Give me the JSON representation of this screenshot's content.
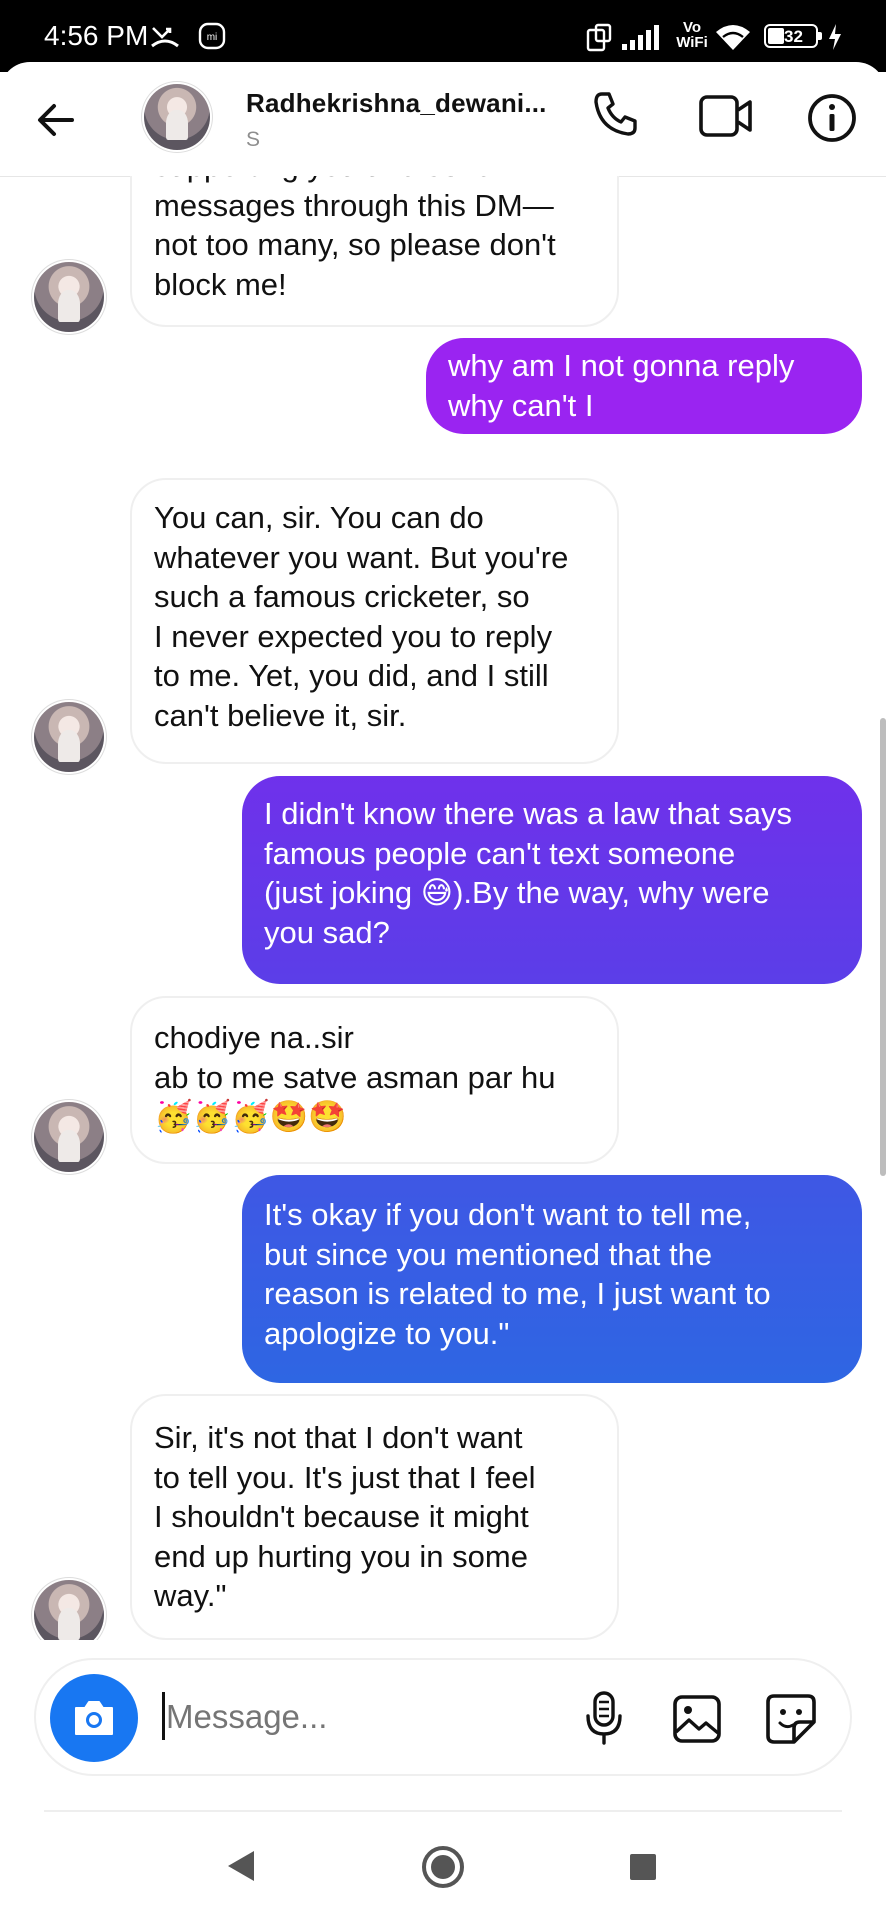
{
  "status_bar": {
    "time": "4:56 PM",
    "icons": [
      "missed-call-icon",
      "mi-icon",
      "screen-rotate-icon",
      "signal-icon",
      "vowifi-icon",
      "wifi-icon",
      "battery-icon",
      "charging-icon"
    ],
    "vowifi_top": "Vo",
    "vowifi_bottom": "WiFi",
    "battery": "32"
  },
  "header": {
    "name": "Radhekrishna_dewani...",
    "subtitle": "S"
  },
  "messages": [
    {
      "side": "in",
      "text": "supporting you and send\nmessages through this DM—\nnot too many, so please don't\nblock me!"
    },
    {
      "side": "out",
      "text": "why am I not gonna reply\nwhy can't I"
    },
    {
      "side": "in",
      "text": "You can, sir. You can do\nwhatever you want. But you're\nsuch a famous cricketer, so\nI never expected you to reply\nto me. Yet, you did, and I still\ncan't believe it, sir."
    },
    {
      "side": "out",
      "text": "I didn't know there was a law that says\nfamous people can't text someone\n(just joking 😅).By the way, why were\nyou sad?"
    },
    {
      "side": "in",
      "text": "chodiye na..sir\nab to me satve asman par hu\n🥳🥳🥳🤩🤩"
    },
    {
      "side": "out",
      "text": "It's okay if you don't want to tell me,\nbut since you mentioned that the\nreason is related to me, I just want to\napologize to you.\""
    },
    {
      "side": "in",
      "text": "Sir, it's not that I don't want\nto tell you. It's just that I feel\nI shouldn't because it might\nend up hurting you in some\nway.\""
    }
  ],
  "composer": {
    "placeholder": "Message...",
    "value": ""
  },
  "colors": {
    "gradient_top": "#9b26f2",
    "gradient_mid": "#6a3ae8",
    "gradient_bottom": "#2f66e4",
    "camera": "#1877f2"
  }
}
